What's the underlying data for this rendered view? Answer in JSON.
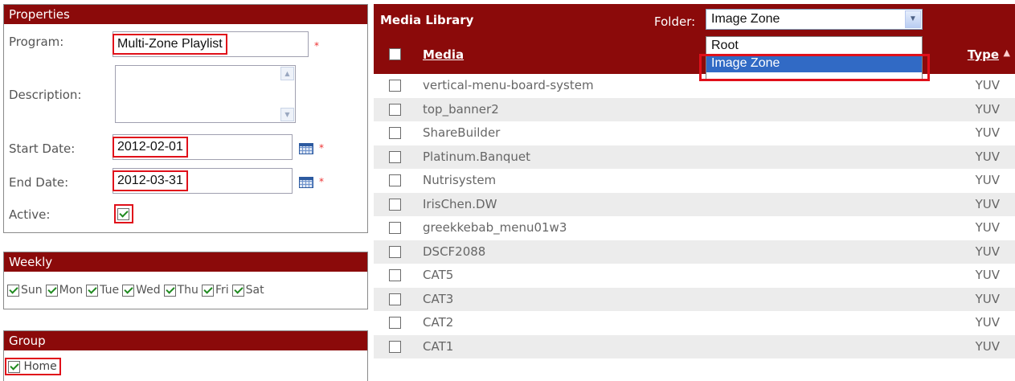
{
  "properties": {
    "title": "Properties",
    "program_label": "Program:",
    "program_value": "Multi-Zone Playlist",
    "description_label": "Description:",
    "start_label": "Start Date:",
    "start_value": "2012-02-01",
    "end_label": "End Date:",
    "end_value": "2012-03-31",
    "active_label": "Active:",
    "required_mark": "*"
  },
  "weekly": {
    "title": "Weekly",
    "days": [
      "Sun",
      "Mon",
      "Tue",
      "Wed",
      "Thu",
      "Fri",
      "Sat"
    ]
  },
  "group": {
    "title": "Group",
    "item": "Home"
  },
  "media_library": {
    "title": "Media Library",
    "folder_label": "Folder:",
    "folder_value": "Image Zone",
    "folder_options": [
      "Root",
      "Image Zone"
    ],
    "col_media": "Media",
    "col_type": "Type",
    "rows": [
      {
        "name": "vertical-menu-board-system",
        "type": "YUV"
      },
      {
        "name": "top_banner2",
        "type": "YUV"
      },
      {
        "name": "ShareBuilder",
        "type": "YUV"
      },
      {
        "name": "Platinum.Banquet",
        "type": "YUV"
      },
      {
        "name": "Nutrisystem",
        "type": "YUV"
      },
      {
        "name": "IrisChen.DW",
        "type": "YUV"
      },
      {
        "name": "greekkebab_menu01w3",
        "type": "YUV"
      },
      {
        "name": "DSCF2088",
        "type": "YUV"
      },
      {
        "name": "CAT5",
        "type": "YUV"
      },
      {
        "name": "CAT3",
        "type": "YUV"
      },
      {
        "name": "CAT2",
        "type": "YUV"
      },
      {
        "name": "CAT1",
        "type": "YUV"
      }
    ]
  },
  "colors": {
    "header_bg": "#8b0a0a",
    "highlight_border": "#e0101a",
    "selected_option": "#316ac5"
  }
}
